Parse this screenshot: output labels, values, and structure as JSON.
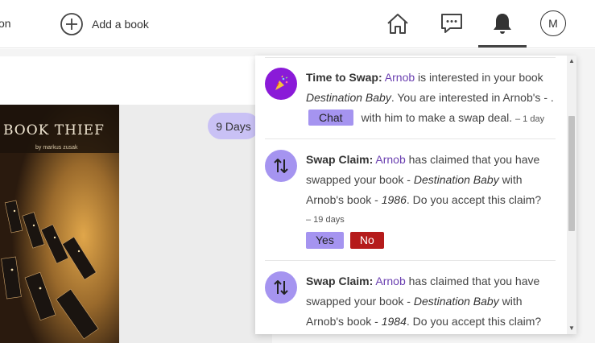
{
  "nav": {
    "cut_link_label": "on",
    "add_book_label": "Add a book",
    "home_icon": "home-icon",
    "chat_icon": "chat-bubble-icon",
    "bell_icon": "bell-icon",
    "avatar_initial": "M"
  },
  "background": {
    "book_cover_text": "BOOK THIEF",
    "book_cover_author": "by markus zusak",
    "days_badge": "9 Days"
  },
  "notifications": [
    {
      "icon": "party-popper-icon",
      "title": "Time to Swap:",
      "user": "Arnob",
      "text_1": "is interested in your book",
      "book": "Destination Baby",
      "text_2": ". You are interested in Arnob's - .",
      "chat_button": "Chat",
      "text_3": "with him to make a swap deal.",
      "time": "– 1 day"
    },
    {
      "icon": "swap-arrows-icon",
      "title": "Swap Claim:",
      "user": "Arnob",
      "text_1": "has claimed that you have swapped your book -",
      "book": "Destination Baby",
      "text_2": "with Arnob's book -",
      "other_book": "1986",
      "text_3": ". Do you accept this claim?",
      "time": "– 19 days",
      "yes_button": "Yes",
      "no_button": "No"
    },
    {
      "icon": "swap-arrows-icon",
      "title": "Swap Claim:",
      "user": "Arnob",
      "text_1": "has claimed that you have swapped your book -",
      "book": "Destination Baby",
      "text_2": "with Arnob's book -",
      "other_book": "1984",
      "text_3": ". Do you accept this claim?"
    }
  ],
  "colors": {
    "accent": "#a594f0",
    "user_link": "#6a3fb0",
    "no_button": "#b51b1b",
    "party_icon_bg": "#8a1ad8",
    "swap_icon_bg": "#a594f0"
  }
}
